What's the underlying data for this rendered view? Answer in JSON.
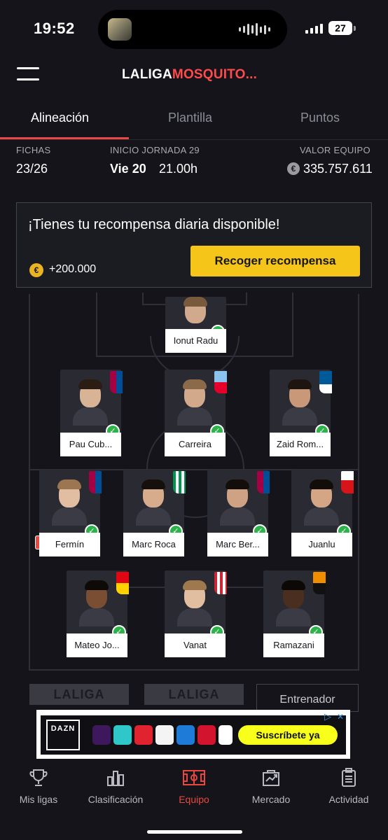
{
  "status_bar": {
    "time": "19:52",
    "battery": "27"
  },
  "header": {
    "title_white": "LALIGA",
    "title_red": "MOSQUITO..."
  },
  "tabs": [
    {
      "label": "Alineación",
      "active": true
    },
    {
      "label": "Plantilla",
      "active": false
    },
    {
      "label": "Puntos",
      "active": false
    }
  ],
  "info": {
    "fichas_label": "FICHAS",
    "fichas_value": "23/26",
    "jornada_label": "INICIO JORNADA 29",
    "jornada_day": "Vie 20",
    "jornada_time": "21.00h",
    "valor_label": "VALOR EQUIPO",
    "valor_value": "335.757.611"
  },
  "reward": {
    "title": "¡Tienes tu recompensa diaria disponible!",
    "amount": "+200.000",
    "button": "Recoger recompensa"
  },
  "lineup": {
    "goalkeeper": [
      {
        "name": "Ionut Radu",
        "checked": true
      }
    ],
    "defenders": [
      {
        "name": "Pau Cub...",
        "checked": true,
        "crest_color": "#a50044"
      },
      {
        "name": "Carreira",
        "checked": true,
        "crest_color": "#8ac3ee"
      },
      {
        "name": "Zaid Rom...",
        "checked": true,
        "crest_color": "#005999"
      }
    ],
    "midfielders": [
      {
        "name": "Fermín",
        "checked": true,
        "captain": "C",
        "crest_color": "#a50044"
      },
      {
        "name": "Marc Roca",
        "checked": true,
        "crest_color": "#00954c"
      },
      {
        "name": "Marc Ber...",
        "checked": true,
        "crest_color": "#a50044"
      },
      {
        "name": "Juanlu",
        "checked": true,
        "crest_color": "#d7141a"
      }
    ],
    "forwards": [
      {
        "name": "Mateo Jo...",
        "checked": true,
        "crest_color": "#e20613"
      },
      {
        "name": "Vanat",
        "checked": true,
        "crest_color": "#cd2534"
      },
      {
        "name": "Ramazani",
        "checked": true,
        "crest_color": "#f18e00"
      }
    ]
  },
  "bench": {
    "slot1": "LALIGA",
    "slot2": "LALIGA",
    "coach": "Entrenador"
  },
  "ad": {
    "brand": "DAZN",
    "cta": "Suscríbete ya"
  },
  "bottom_nav": [
    {
      "label": "Mis ligas",
      "icon": "trophy-icon",
      "active": false
    },
    {
      "label": "Clasificación",
      "icon": "bar-chart-icon",
      "active": false
    },
    {
      "label": "Equipo",
      "icon": "pitch-icon",
      "active": true
    },
    {
      "label": "Mercado",
      "icon": "market-icon",
      "active": false
    },
    {
      "label": "Actividad",
      "icon": "clipboard-icon",
      "active": false
    }
  ],
  "colors": {
    "accent": "#e8483f",
    "cta": "#f5c51a",
    "check": "#2db34a"
  }
}
